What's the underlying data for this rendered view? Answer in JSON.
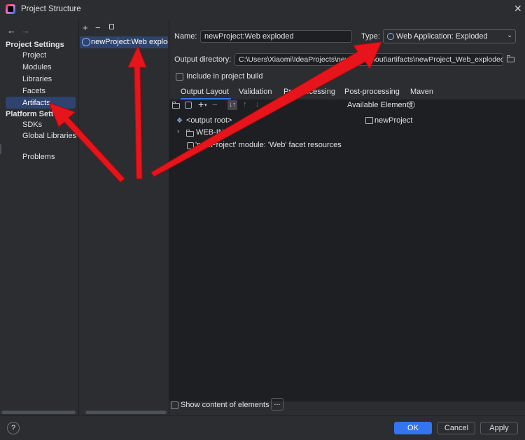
{
  "window": {
    "title": "Project Structure"
  },
  "sidebar": {
    "project_settings_header": "Project Settings",
    "project_items": [
      "Project",
      "Modules",
      "Libraries",
      "Facets",
      "Artifacts"
    ],
    "platform_settings_header": "Platform Settings",
    "platform_items": [
      "SDKs",
      "Global Libraries"
    ],
    "problems": "Problems",
    "selected": "Artifacts"
  },
  "artifacts_list": {
    "items": [
      "newProject:Web exploded"
    ]
  },
  "main": {
    "name_label": "Name:",
    "name_value": "newProject:Web exploded",
    "type_label": "Type:",
    "type_value": "Web Application: Exploded",
    "output_dir_label": "Output directory:",
    "output_dir_value": "C:\\Users\\Xiaomi\\IdeaProjects\\newProject\\out\\artifacts\\newProject_Web_exploded",
    "include_in_build_label": "Include in project build",
    "tabs": [
      "Output Layout",
      "Validation",
      "Pre-processing",
      "Post-processing",
      "Maven"
    ],
    "available_elements_label": "Available Elements",
    "tree": {
      "root": "<output root>",
      "web_inf": "WEB-INF",
      "facet_resources": "'newProject' module: 'Web' facet resources"
    },
    "available_tree": [
      "newProject"
    ],
    "show_content_label": "Show content of elements",
    "more_button": "..."
  },
  "footer": {
    "help": "?",
    "ok": "OK",
    "cancel": "Cancel",
    "apply": "Apply"
  },
  "colors": {
    "background": "#2b2d30",
    "panel_dark": "#1e1f22",
    "selection": "#2e436e",
    "accent": "#3574f0",
    "annotation_arrow": "#e8141b"
  }
}
